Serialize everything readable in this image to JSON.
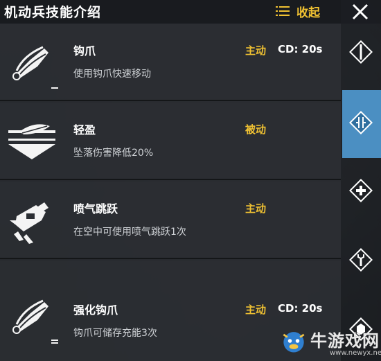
{
  "header": {
    "title": "机动兵技能介绍",
    "collapse_label": "收起"
  },
  "skills": [
    {
      "name": "钩爪",
      "desc": "使用钩爪快速移动",
      "type": "主动",
      "cd": "CD: 20s",
      "icon": "grappling-hook-icon"
    },
    {
      "name": "轻盈",
      "desc": "坠落伤害降低20%",
      "type": "被动",
      "cd": "",
      "icon": "feather-icon"
    },
    {
      "name": "喷气跳跃",
      "desc": "在空中可使用喷气跳跃1次",
      "type": "主动",
      "cd": "",
      "icon": "jetpack-icon"
    },
    {
      "name": "强化钩爪",
      "desc": "钩爪可储存充能3次",
      "type": "主动",
      "cd": "CD: 20s",
      "icon": "grappling-hook-icon"
    }
  ],
  "sidebar": {
    "icons": [
      "blade-icon",
      "mobile-soldier-icon",
      "medic-cross-icon",
      "wrench-icon",
      "armor-icon"
    ],
    "active_index": 1
  },
  "watermark": {
    "text": "牛游戏网",
    "url": "www.newyx.net"
  },
  "colors": {
    "accent_yellow": "#f1c232",
    "active_blue": "#4b8fc2"
  }
}
